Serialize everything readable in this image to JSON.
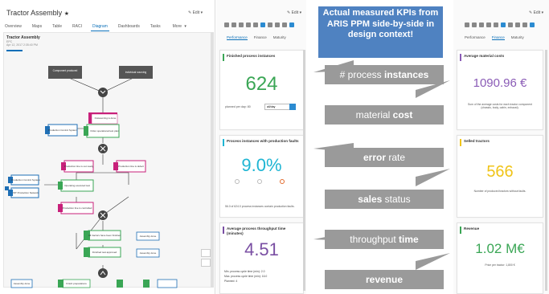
{
  "app": {
    "title": "Tractor Assembly",
    "edit_label": "Edit",
    "tabs": [
      "Overview",
      "Maps",
      "Table",
      "RACI",
      "Diagram",
      "Dashboards",
      "Tasks",
      "More"
    ],
    "active_tab": "Diagram",
    "model": {
      "name": "Tractor Assembly",
      "line2": "EPC",
      "line3": "Apr 12, 2017 2:35:40 PM"
    }
  },
  "diagram": {
    "nodes": [
      "Component produced",
      "Individual sourcing",
      "Outsourcing is done",
      "Production Control System",
      "Order operational test plan",
      "Production line is out ready",
      "Production line is defect",
      "Production Control System",
      "WT Production Network",
      "Operating executed test",
      "Production line is controlled",
      "All tractors have been finished",
      "Assembly done",
      "Finished test approved",
      "Assembly done",
      "Finish preparations",
      "Assembly done"
    ]
  },
  "kpi_panel_mid": {
    "edit_label": "Edit",
    "subtabs": [
      "Performance",
      "Finance",
      "Maturity"
    ],
    "active_subtab": "Performance",
    "cards": [
      {
        "title": "Finished process instances",
        "value": "624",
        "color": "#3aa655",
        "note_label": "planned per day: 80",
        "select_value": "all/day"
      },
      {
        "title": "Process instances with production faults",
        "value": "9.0%",
        "color": "#1fb5d3",
        "note": "56.0 of 624.0 process instances contain production faults."
      },
      {
        "title": "Average process throughput time (minutes)",
        "value": "4.51",
        "color": "#7a4fa3",
        "lines": [
          "Min. process cycle time (min): 2.0",
          "Max. process cycle time (min): 16.0",
          "Planned: 4"
        ]
      }
    ]
  },
  "kpi_panel_right": {
    "edit_label": "Edit",
    "subtabs": [
      "Performance",
      "Finance",
      "Maturity"
    ],
    "active_subtab": "Finance",
    "cards": [
      {
        "title": "Average material costs",
        "value": "1090.96 €",
        "color": "#8a5bb6",
        "note": "Sum of the average costs for each tractor component (chassis, body, cabin, exhaust)."
      },
      {
        "title": "Selled tractors",
        "value": "566",
        "color": "#f0c419",
        "note": "Number of produced tractors without faults."
      },
      {
        "title": "Revenue",
        "value": "1.02 M€",
        "color": "#3aa655",
        "note": "Price per tractor: 1,800 €"
      }
    ]
  },
  "center": {
    "headline": "Actual measured KPIs from ARIS PPM side-by-side in design context!",
    "headline_color": "#4f82c1",
    "label_color": "#9a9a9a",
    "labels": [
      {
        "normal": "# process ",
        "bold": "instances",
        "after": ""
      },
      {
        "normal": "material ",
        "bold": "cost",
        "after": ""
      },
      {
        "normal": "",
        "bold": "error",
        "after": " rate"
      },
      {
        "normal": "",
        "bold": "sales",
        "after": " status"
      },
      {
        "normal": "throughput ",
        "bold": "time",
        "after": ""
      },
      {
        "normal": "",
        "bold": "revenue",
        "after": ""
      }
    ]
  }
}
